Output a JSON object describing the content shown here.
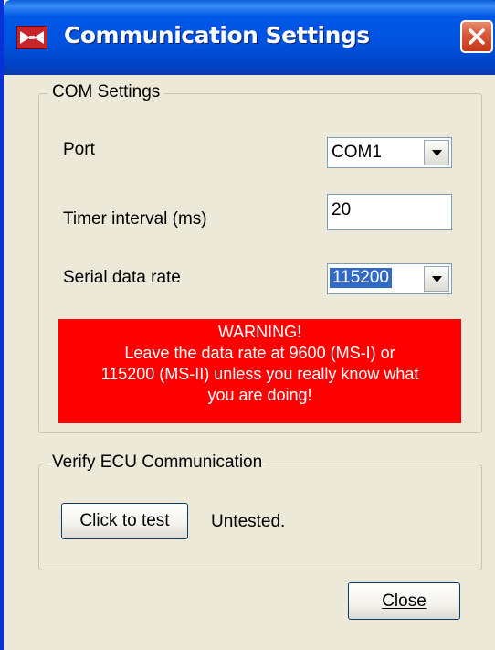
{
  "window": {
    "title": "Communication Settings"
  },
  "com_settings": {
    "legend": "COM Settings",
    "port_label": "Port",
    "port_value": "COM1",
    "timer_label": "Timer interval (ms)",
    "timer_value": "20",
    "rate_label": "Serial data rate",
    "rate_value": "115200",
    "warning_lines": [
      "WARNING!",
      "Leave the data rate at 9600 (MS-I) or",
      "115200 (MS-II) unless you really know what",
      "you are doing!"
    ]
  },
  "verify": {
    "legend": "Verify ECU Communication",
    "test_button": "Click to test",
    "status": "Untested."
  },
  "footer": {
    "close_button": "Close"
  },
  "colors": {
    "warning_bg": "#ff0000",
    "titlebar": "#0058e6",
    "selection": "#316ac5"
  }
}
